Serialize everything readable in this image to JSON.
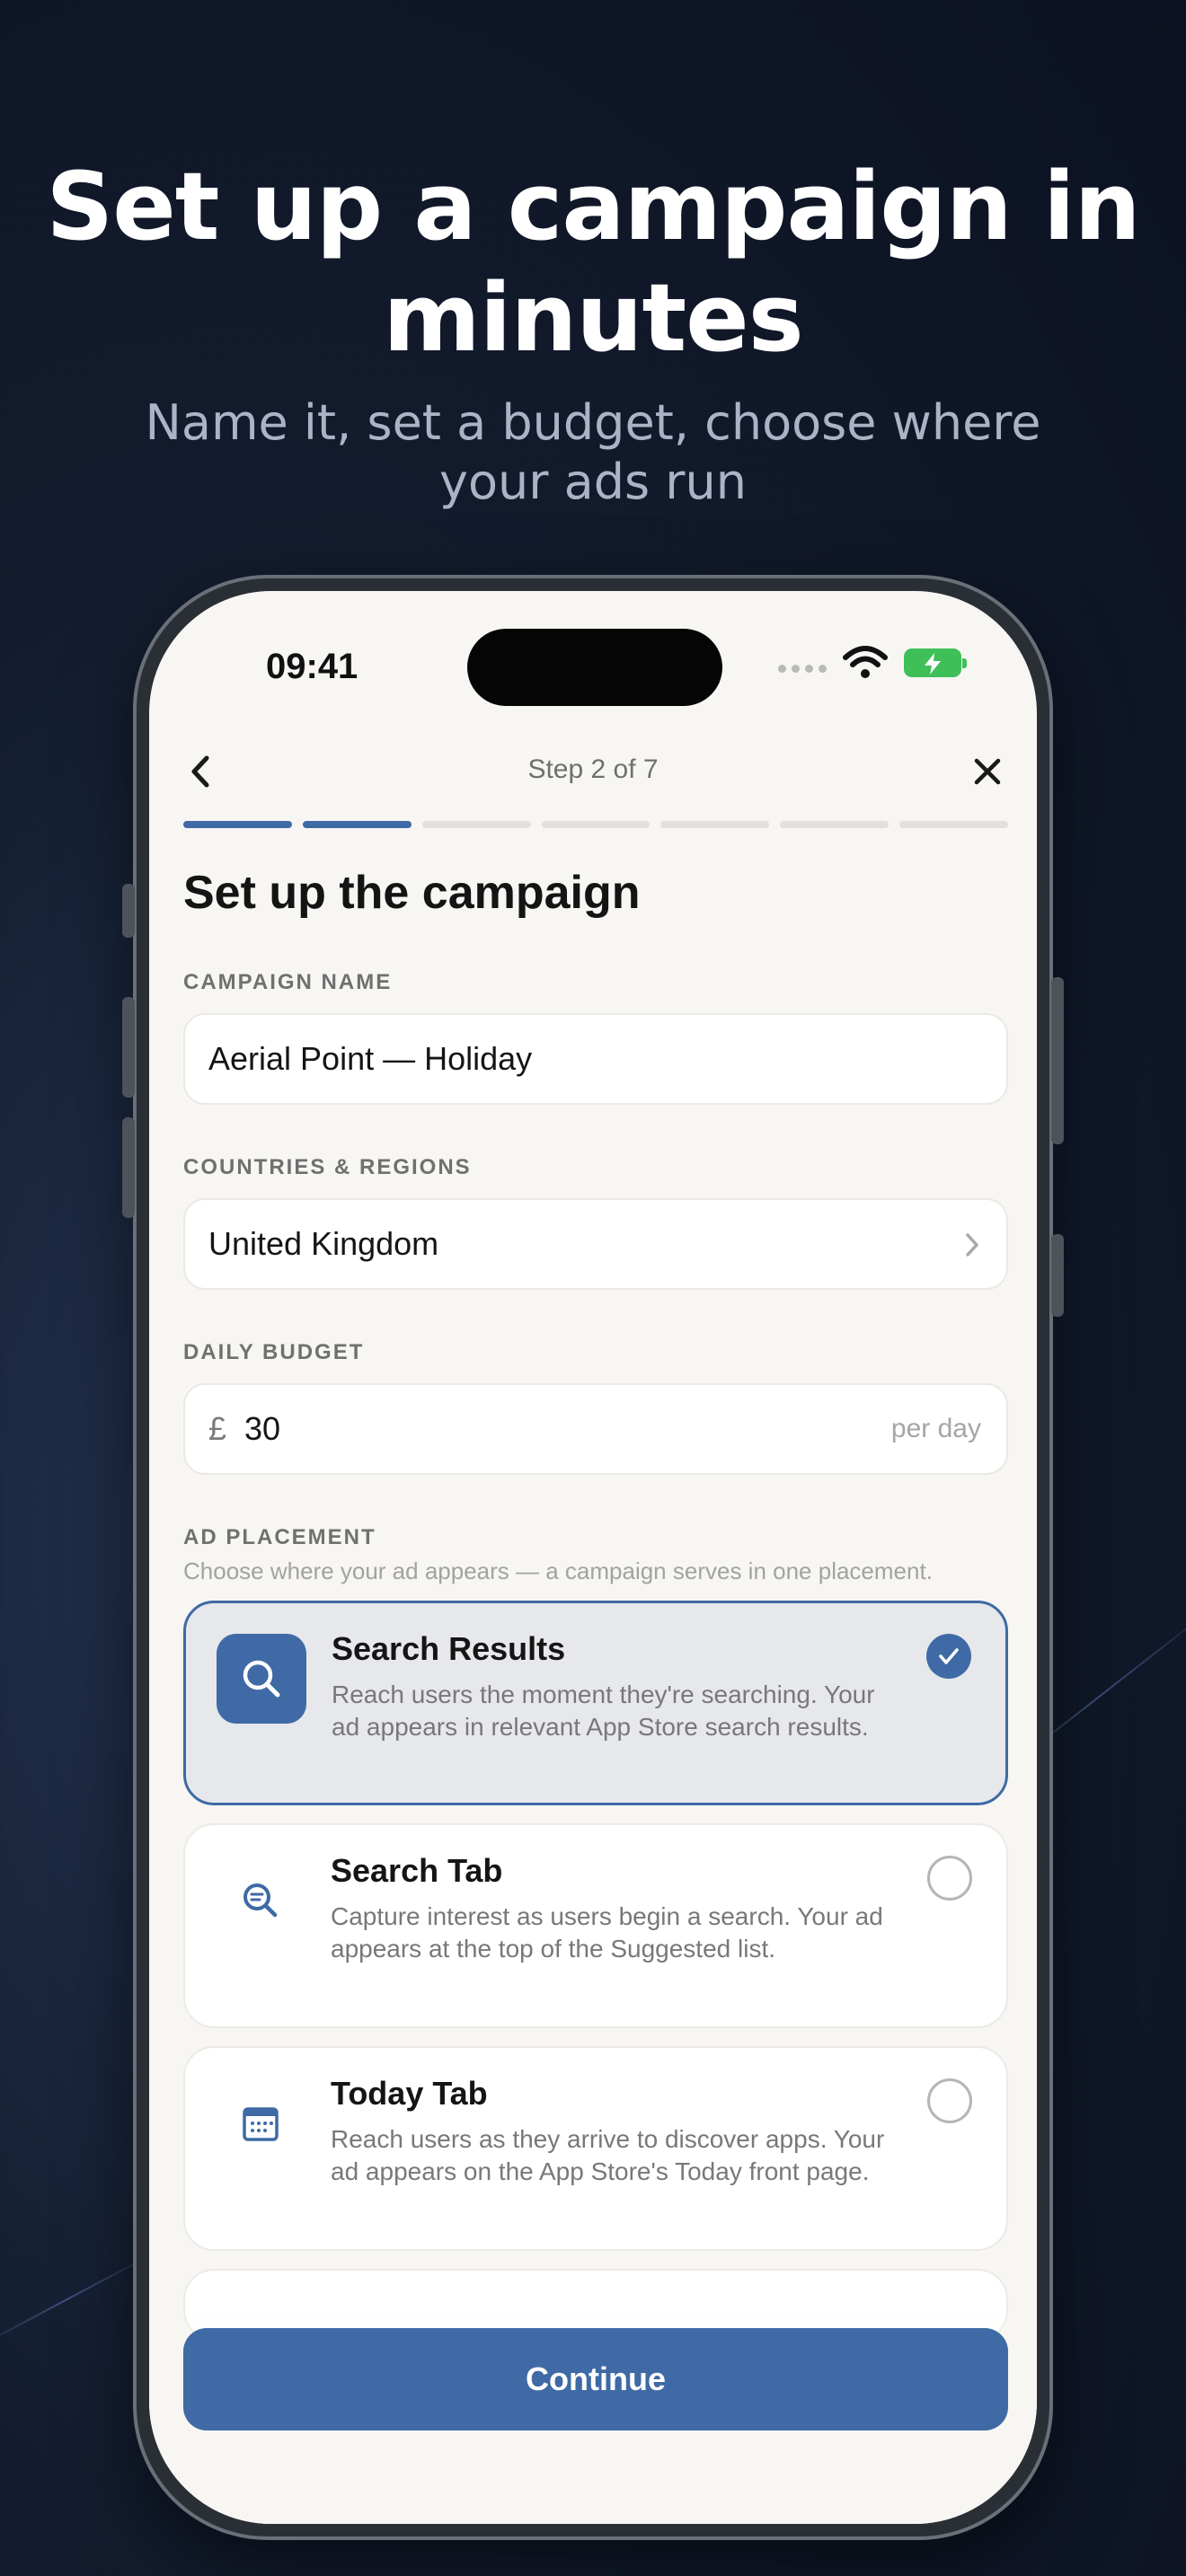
{
  "hero": {
    "title": "Set up a campaign in minutes",
    "subtitle": "Name it, set a budget, choose where your ads run"
  },
  "status_bar": {
    "time": "09:41"
  },
  "nav": {
    "step": "Step 2 of 7",
    "back_icon": "chevron-left-icon",
    "close_icon": "close-icon"
  },
  "progress": {
    "total_steps": 7,
    "completed_steps": 2,
    "accent_color": "#3f6aa5"
  },
  "form": {
    "title": "Set up the campaign",
    "campaign_name": {
      "label": "CAMPAIGN NAME",
      "value": "Aerial Point — Holiday"
    },
    "countries": {
      "label": "COUNTRIES & REGIONS",
      "value": "United Kingdom"
    },
    "budget": {
      "label": "DAILY BUDGET",
      "currency": "£",
      "value": "30",
      "suffix": "per day"
    },
    "placement": {
      "label": "AD PLACEMENT",
      "helper": "Choose where your ad appears — a campaign serves in one placement.",
      "options": [
        {
          "title": "Search Results",
          "description": "Reach users the moment they're searching. Your ad appears in relevant App Store search results.",
          "icon": "search-icon",
          "selected": true
        },
        {
          "title": "Search Tab",
          "description": "Capture interest as users begin a search. Your ad appears at the top of the Suggested list.",
          "icon": "search-list-icon",
          "selected": false
        },
        {
          "title": "Today Tab",
          "description": "Reach users as they arrive to discover apps. Your ad appears on the App Store's Today front page.",
          "icon": "calendar-icon",
          "selected": false
        }
      ]
    }
  },
  "footer": {
    "continue_label": "Continue"
  }
}
